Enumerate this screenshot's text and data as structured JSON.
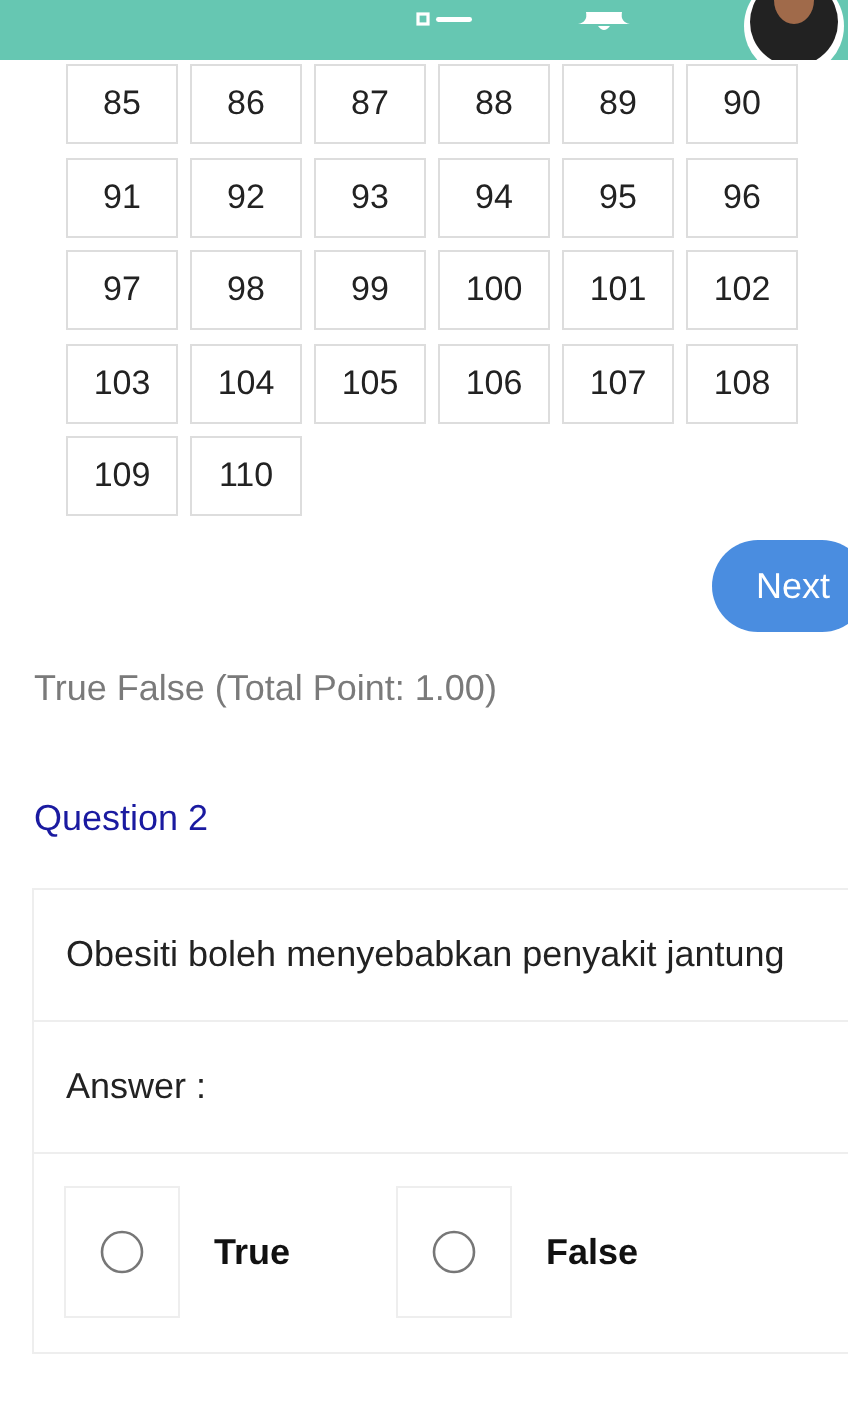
{
  "question_numbers": [
    "85",
    "86",
    "87",
    "88",
    "89",
    "90",
    "91",
    "92",
    "93",
    "94",
    "95",
    "96",
    "97",
    "98",
    "99",
    "100",
    "101",
    "102",
    "103",
    "104",
    "105",
    "106",
    "107",
    "108",
    "109",
    "110"
  ],
  "next_button": "Next",
  "section_title": "True False (Total Point: 1.00)",
  "question": {
    "title": "Question 2",
    "text": "Obesiti boleh menyebabkan penyakit jantung",
    "answer_label": "Answer :",
    "options": [
      {
        "label": "True",
        "selected": false
      },
      {
        "label": "False",
        "selected": false
      }
    ]
  }
}
